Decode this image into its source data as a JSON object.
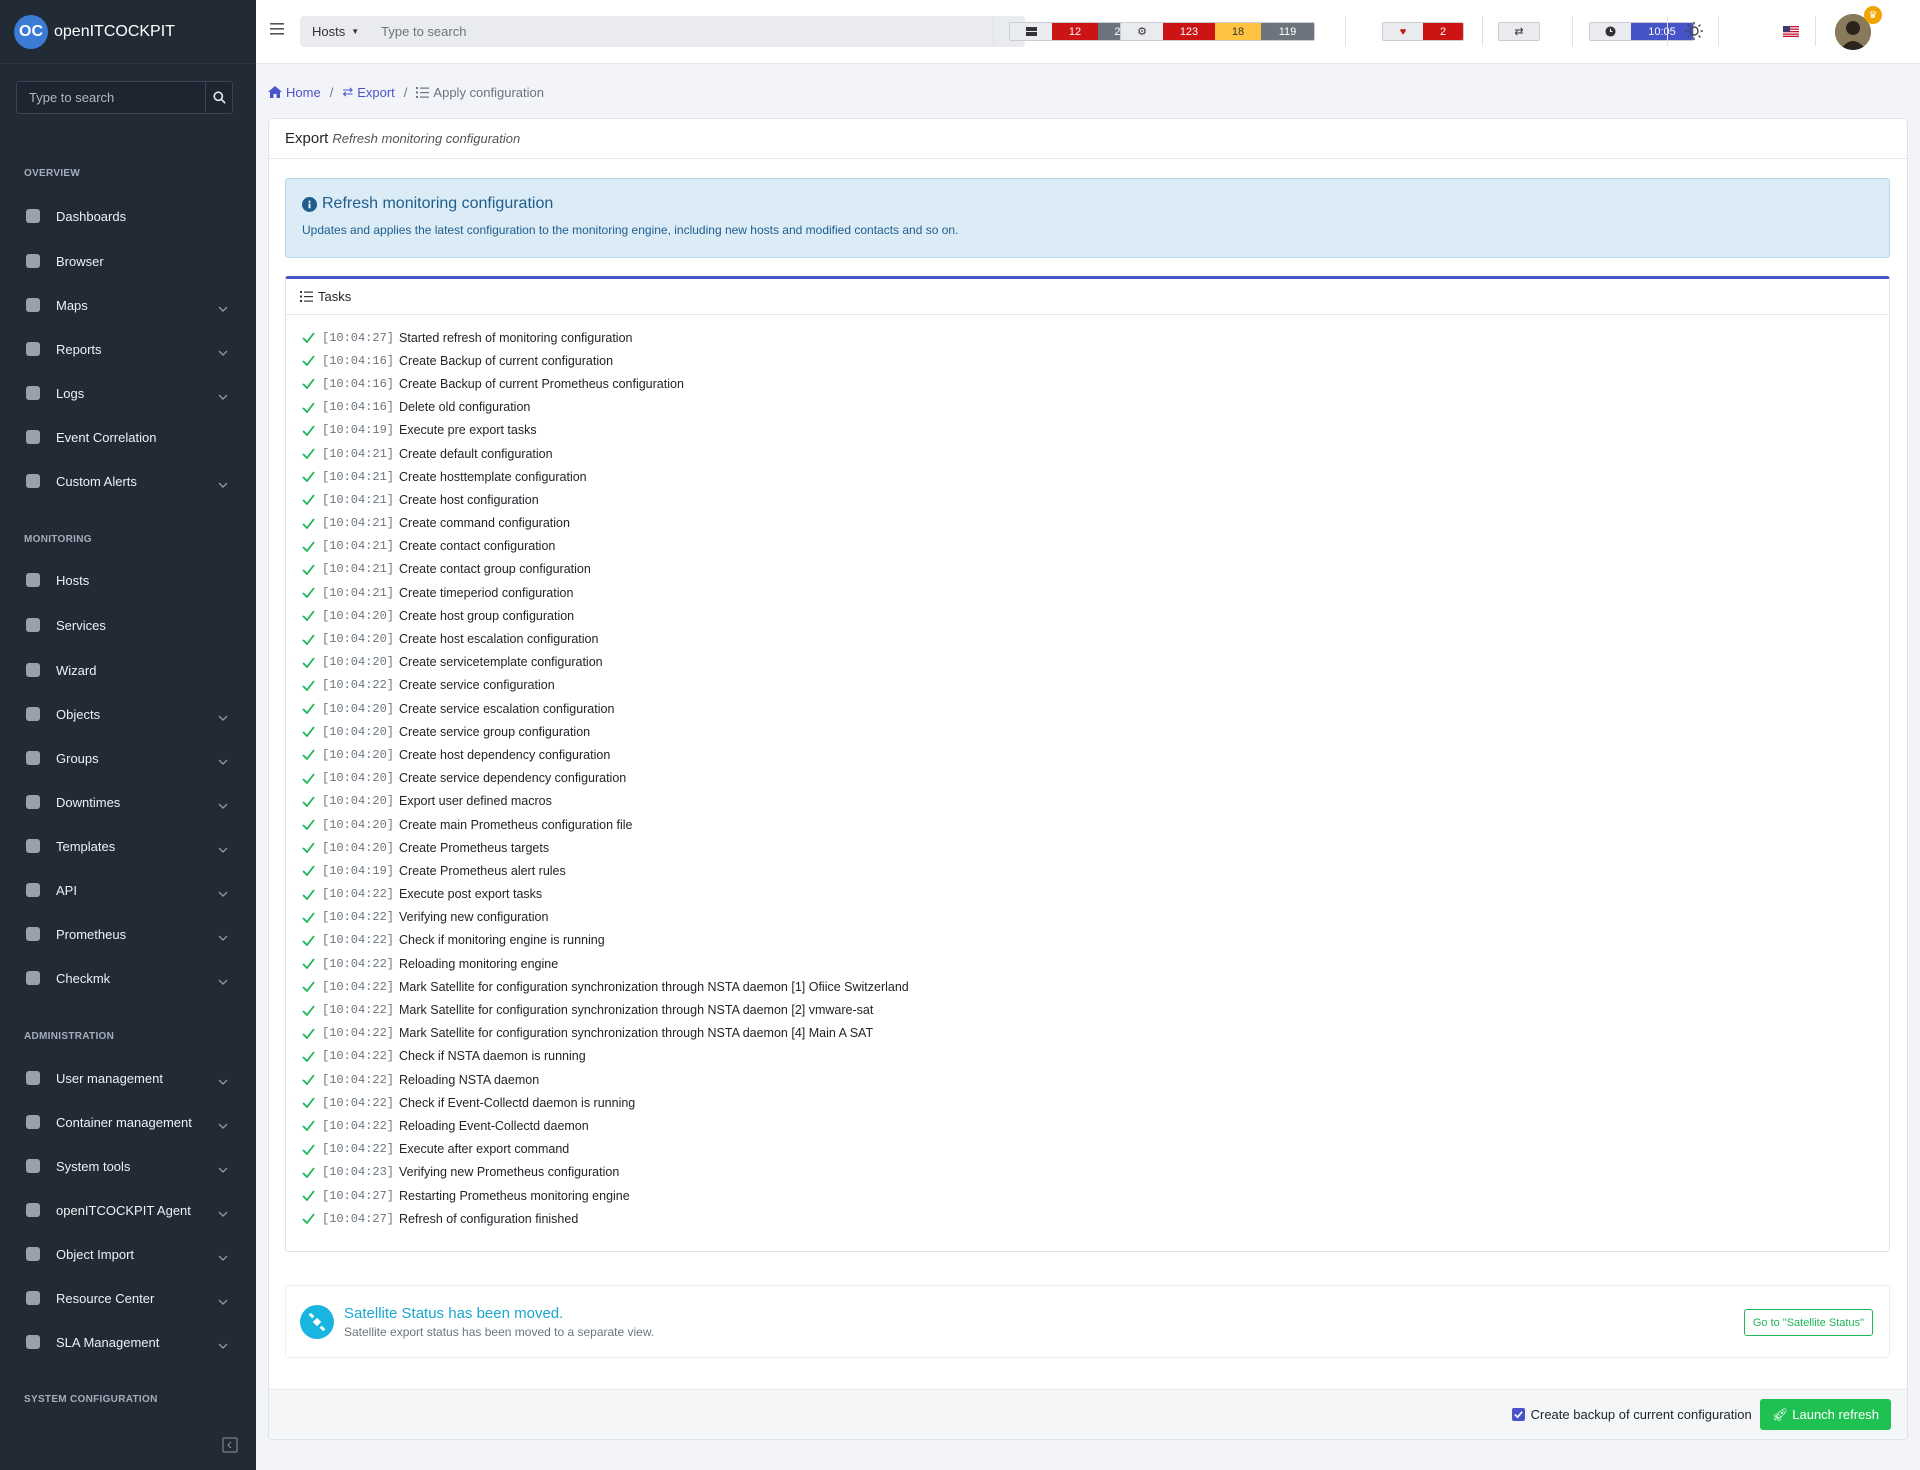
{
  "brand": {
    "logo_text": "OC",
    "name": "openITCOCKPIT"
  },
  "sidebar": {
    "search_placeholder": "Type to search",
    "sections": {
      "overview": "OVERVIEW",
      "monitoring": "MONITORING",
      "administration": "ADMINISTRATION",
      "system_configuration": "SYSTEM CONFIGURATION"
    },
    "overview_items": [
      "Dashboards",
      "Browser",
      "Maps",
      "Reports",
      "Logs",
      "Event Correlation",
      "Custom Alerts"
    ],
    "monitoring_items": [
      "Hosts",
      "Services",
      "Wizard",
      "Objects",
      "Groups",
      "Downtimes",
      "Templates",
      "API",
      "Prometheus",
      "Checkmk"
    ],
    "administration_items": [
      "User management",
      "Container management",
      "System tools",
      "openITCOCKPIT Agent",
      "Object Import",
      "Resource Center",
      "SLA Management"
    ]
  },
  "topbar": {
    "search_scope": "Hosts",
    "search_placeholder": "Type to search",
    "host_counts": [
      "12",
      "22"
    ],
    "service_counts": [
      "123",
      "18",
      "119"
    ],
    "heart_count": "2",
    "clock": "10:05"
  },
  "breadcrumb": {
    "home": "Home",
    "export": "Export",
    "current": "Apply configuration"
  },
  "panel": {
    "title": "Export",
    "subtitle": "Refresh monitoring configuration"
  },
  "info": {
    "title": "Refresh monitoring configuration",
    "text": "Updates and applies the latest configuration to the monitoring engine, including new hosts and modified contacts and so on."
  },
  "tasks": {
    "header": "Tasks",
    "items": [
      {
        "time": "[10:04:27]",
        "label": "Started refresh of monitoring configuration"
      },
      {
        "time": "[10:04:16]",
        "label": "Create Backup of current configuration"
      },
      {
        "time": "[10:04:16]",
        "label": "Create Backup of current Prometheus configuration"
      },
      {
        "time": "[10:04:16]",
        "label": "Delete old configuration"
      },
      {
        "time": "[10:04:19]",
        "label": "Execute pre export tasks"
      },
      {
        "time": "[10:04:21]",
        "label": "Create default configuration"
      },
      {
        "time": "[10:04:21]",
        "label": "Create hosttemplate configuration"
      },
      {
        "time": "[10:04:21]",
        "label": "Create host configuration"
      },
      {
        "time": "[10:04:21]",
        "label": "Create command configuration"
      },
      {
        "time": "[10:04:21]",
        "label": "Create contact configuration"
      },
      {
        "time": "[10:04:21]",
        "label": "Create contact group configuration"
      },
      {
        "time": "[10:04:21]",
        "label": "Create timeperiod configuration"
      },
      {
        "time": "[10:04:20]",
        "label": "Create host group configuration"
      },
      {
        "time": "[10:04:20]",
        "label": "Create host escalation configuration"
      },
      {
        "time": "[10:04:20]",
        "label": "Create servicetemplate configuration"
      },
      {
        "time": "[10:04:22]",
        "label": "Create service configuration"
      },
      {
        "time": "[10:04:20]",
        "label": "Create service escalation configuration"
      },
      {
        "time": "[10:04:20]",
        "label": "Create service group configuration"
      },
      {
        "time": "[10:04:20]",
        "label": "Create host dependency configuration"
      },
      {
        "time": "[10:04:20]",
        "label": "Create service dependency configuration"
      },
      {
        "time": "[10:04:20]",
        "label": "Export user defined macros"
      },
      {
        "time": "[10:04:20]",
        "label": "Create main Prometheus configuration file"
      },
      {
        "time": "[10:04:20]",
        "label": "Create Prometheus targets"
      },
      {
        "time": "[10:04:19]",
        "label": "Create Prometheus alert rules"
      },
      {
        "time": "[10:04:22]",
        "label": "Execute post export tasks"
      },
      {
        "time": "[10:04:22]",
        "label": "Verifying new configuration"
      },
      {
        "time": "[10:04:22]",
        "label": "Check if monitoring engine is running"
      },
      {
        "time": "[10:04:22]",
        "label": "Reloading monitoring engine"
      },
      {
        "time": "[10:04:22]",
        "label": "Mark Satellite for configuration synchronization through NSTA daemon [1] Ofiice Switzerland"
      },
      {
        "time": "[10:04:22]",
        "label": "Mark Satellite for configuration synchronization through NSTA daemon [2] vmware-sat"
      },
      {
        "time": "[10:04:22]",
        "label": "Mark Satellite for configuration synchronization through NSTA daemon [4] Main A SAT"
      },
      {
        "time": "[10:04:22]",
        "label": "Check if NSTA daemon is running"
      },
      {
        "time": "[10:04:22]",
        "label": "Reloading NSTA daemon"
      },
      {
        "time": "[10:04:22]",
        "label": "Check if Event-Collectd daemon is running"
      },
      {
        "time": "[10:04:22]",
        "label": "Reloading Event-Collectd daemon"
      },
      {
        "time": "[10:04:22]",
        "label": "Execute after export command"
      },
      {
        "time": "[10:04:23]",
        "label": "Verifying new Prometheus configuration"
      },
      {
        "time": "[10:04:27]",
        "label": "Restarting Prometheus monitoring engine"
      },
      {
        "time": "[10:04:27]",
        "label": "Refresh of configuration finished"
      }
    ]
  },
  "satellite": {
    "title": "Satellite Status has been moved.",
    "text": "Satellite export status has been moved to a separate view.",
    "button": "Go to \"Satellite Status\""
  },
  "footer": {
    "backup_label": "Create backup of current configuration",
    "backup_checked": true,
    "launch_label": "Launch refresh"
  },
  "colors": {
    "accent": "#4654c8",
    "success": "#1fc152",
    "danger": "#cc1414",
    "warning": "#ffc241",
    "secondary": "#6c757d",
    "info_bg": "#dcecf7",
    "sidebar_bg": "#222a36"
  }
}
